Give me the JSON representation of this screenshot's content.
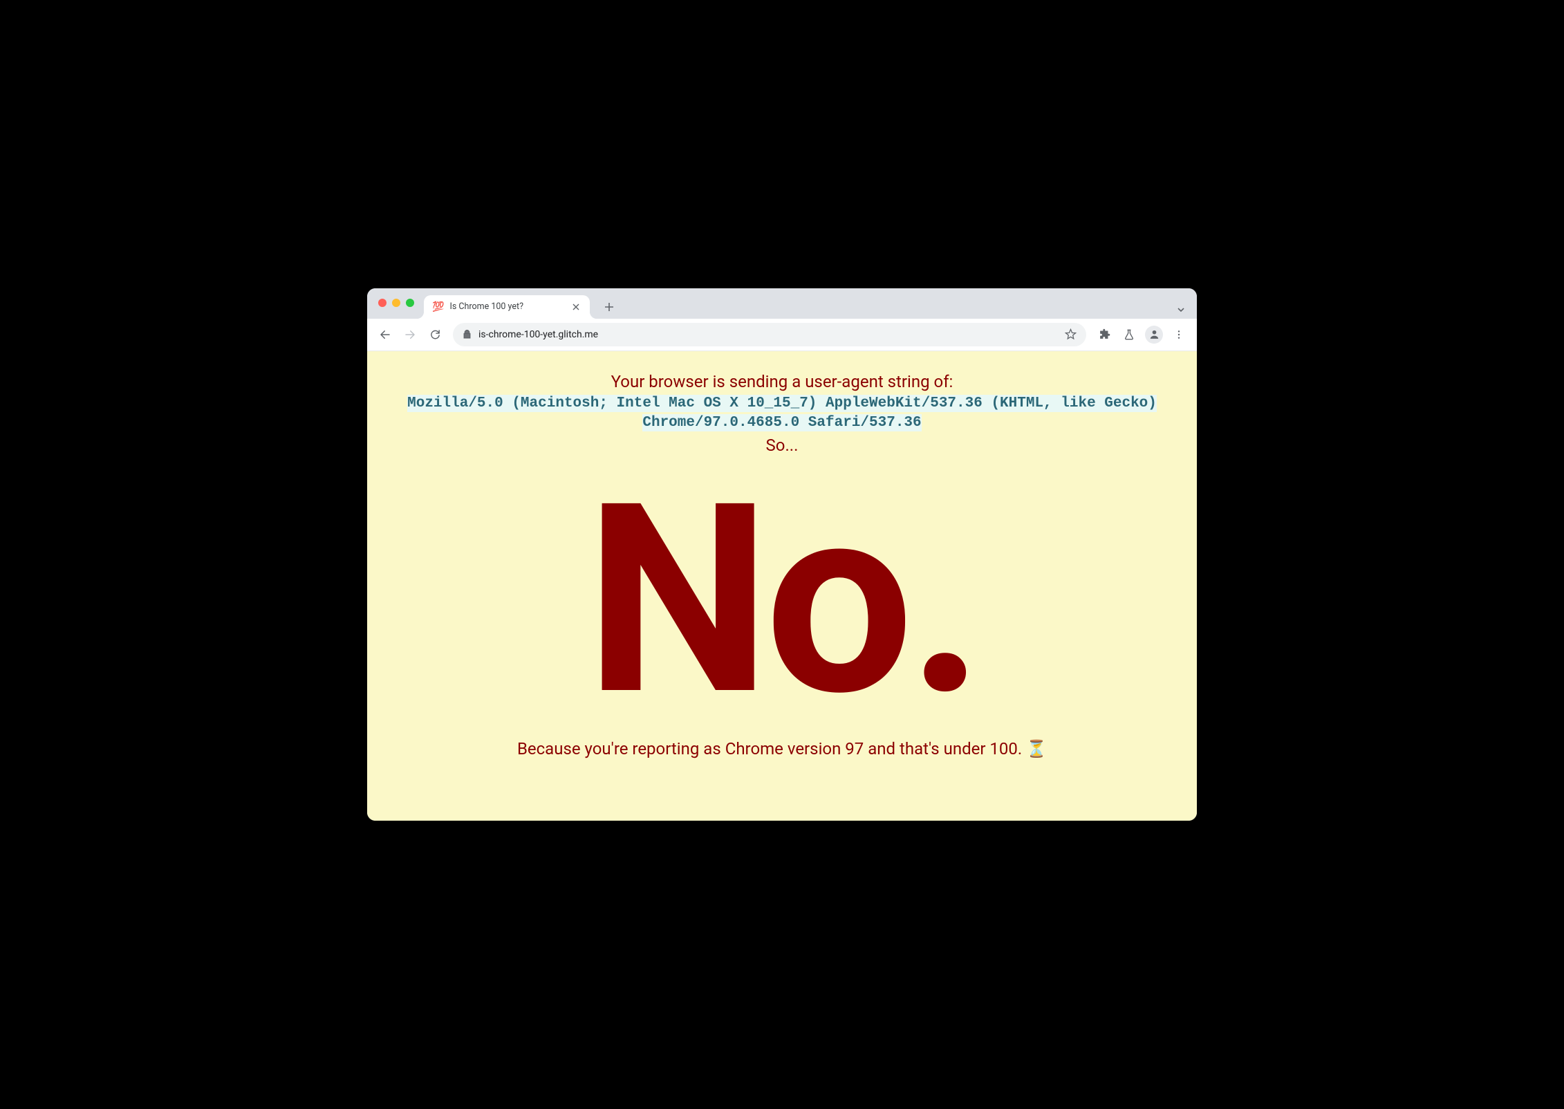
{
  "browser": {
    "tab": {
      "favicon": "💯",
      "title": "Is Chrome 100 yet?"
    },
    "url": "is-chrome-100-yet.glitch.me"
  },
  "page": {
    "heading": "Your browser is sending a user-agent string of:",
    "user_agent": "Mozilla/5.0 (Macintosh; Intel Mac OS X 10_15_7) AppleWebKit/537.36 (KHTML, like Gecko) Chrome/97.0.4685.0 Safari/537.36",
    "so": "So...",
    "answer": "No.",
    "reason": "Because you're reporting as Chrome version 97 and that's under 100. ⏳"
  }
}
